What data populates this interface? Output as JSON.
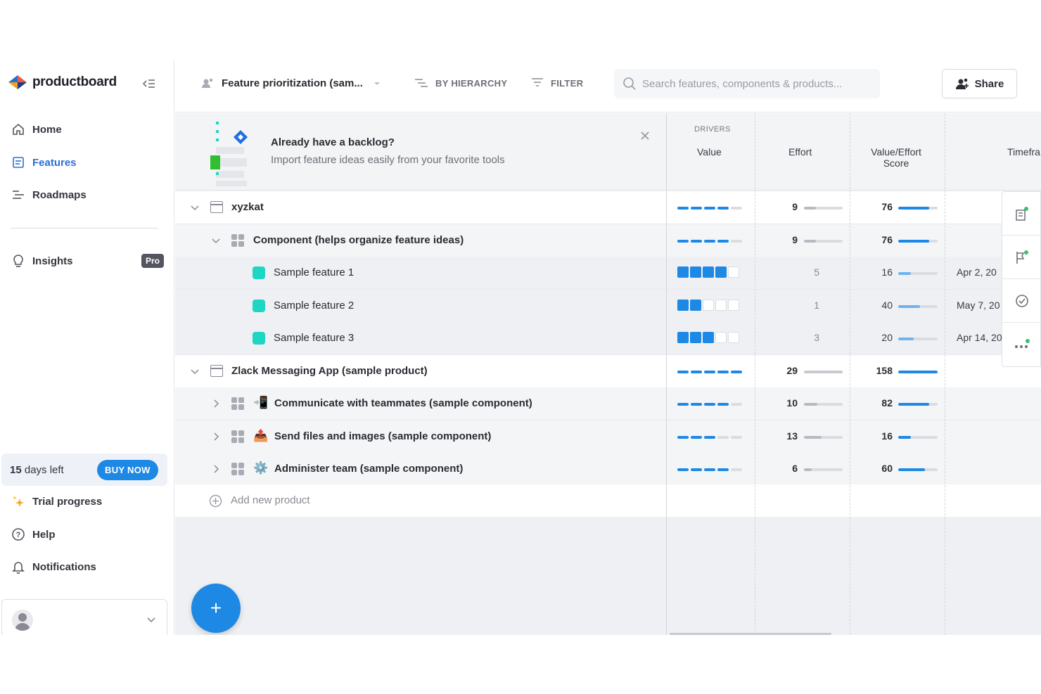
{
  "sidebar": {
    "logo_text": "productboard",
    "nav": [
      {
        "label": "Home",
        "icon": "home-icon"
      },
      {
        "label": "Features",
        "icon": "features-icon",
        "active": true
      },
      {
        "label": "Roadmaps",
        "icon": "roadmaps-icon"
      },
      {
        "label": "Insights",
        "icon": "bulb-icon",
        "badge": "Pro"
      }
    ],
    "trial": {
      "days_num": "15",
      "days_text": " days left",
      "buy_label": "BUY NOW"
    },
    "bottom_nav": [
      {
        "label": "Trial progress",
        "icon": "sparkle-icon"
      },
      {
        "label": "Help",
        "icon": "help-icon"
      },
      {
        "label": "Notifications",
        "icon": "bell-icon"
      }
    ]
  },
  "topbar": {
    "view_name": "Feature prioritization (sam...",
    "hierarchy_label": "BY HIERARCHY",
    "filter_label": "FILTER",
    "search_placeholder": "Search features, components & products...",
    "share_label": "Share"
  },
  "banner": {
    "title": "Already have a backlog?",
    "subtitle": "Import feature ideas easily from your favorite tools"
  },
  "columns": {
    "drivers": "DRIVERS",
    "value": "Value",
    "effort": "Effort",
    "score": "Value/Effort Score",
    "timeframe": "Timefra"
  },
  "rows": [
    {
      "name": "xyzkat",
      "type": "product",
      "value": 4,
      "effort": "9",
      "effort_pct": 0.3,
      "score": "76",
      "score_pct": 0.78
    },
    {
      "name": "Component (helps organize feature ideas)",
      "type": "component",
      "value": 4,
      "effort": "9",
      "effort_pct": 0.3,
      "score": "76",
      "score_pct": 0.78
    },
    {
      "name": "Sample feature 1",
      "type": "feature",
      "value": 4,
      "effort": "5",
      "score": "16",
      "score_pct": 0.33,
      "date": "Apr 2, 20"
    },
    {
      "name": "Sample feature 2",
      "type": "feature",
      "value": 2,
      "effort": "1",
      "score": "40",
      "score_pct": 0.55,
      "date": "May 7, 20"
    },
    {
      "name": "Sample feature 3",
      "type": "feature",
      "value": 3,
      "effort": "3",
      "score": "20",
      "score_pct": 0.4,
      "date": "Apr 14, 20"
    },
    {
      "name": "Zlack Messaging App (sample product)",
      "type": "product",
      "value": 5,
      "effort": "29",
      "effort_pct": 1.0,
      "score": "158",
      "score_pct": 1.0
    },
    {
      "name": "Communicate with teammates (sample component)",
      "type": "component",
      "emoji": "📲",
      "value": 4,
      "effort": "10",
      "effort_pct": 0.35,
      "score": "82",
      "score_pct": 0.78
    },
    {
      "name": "Send files and images (sample component)",
      "type": "component",
      "emoji": "📤",
      "value": 3,
      "effort": "13",
      "effort_pct": 0.45,
      "score": "16",
      "score_pct": 0.33
    },
    {
      "name": "Administer team (sample component)",
      "type": "component",
      "emoji": "⚙️",
      "value": 4,
      "effort": "6",
      "effort_pct": 0.2,
      "score": "60",
      "score_pct": 0.68
    }
  ],
  "add_new_label": "Add new product",
  "fab_label": "+",
  "colors": {
    "accent": "#1e88e5",
    "feature": "#1fd6c3",
    "active_nav": "#2a70d6"
  }
}
